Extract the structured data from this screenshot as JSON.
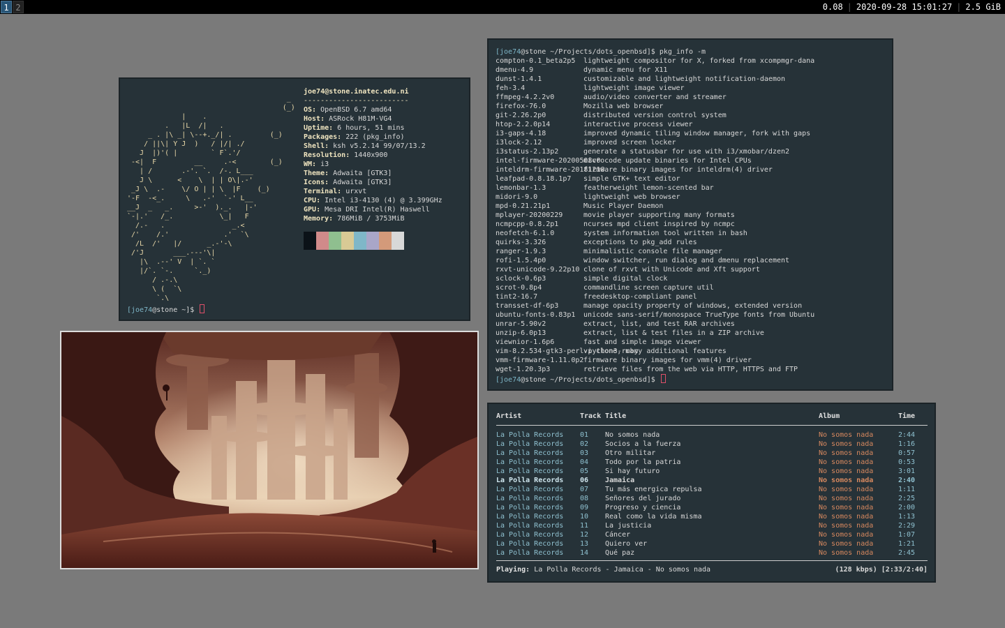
{
  "topbar": {
    "workspaces": [
      "1",
      "2"
    ],
    "load": "0.08",
    "datetime": "2020-09-28 15:01:27",
    "memory": "2.5 GiB"
  },
  "neofetch": {
    "title": "joe74@stone.inatec.edu.ni",
    "underline": "-------------------------",
    "info": [
      {
        "key": "OS",
        "value": "OpenBSD 6.7 amd64"
      },
      {
        "key": "Host",
        "value": "ASRock H81M-VG4"
      },
      {
        "key": "Uptime",
        "value": "6 hours, 51 mins"
      },
      {
        "key": "Packages",
        "value": "222 (pkg_info)"
      },
      {
        "key": "Shell",
        "value": "ksh v5.2.14 99/07/13.2"
      },
      {
        "key": "Resolution",
        "value": "1440x900"
      },
      {
        "key": "WM",
        "value": "i3"
      },
      {
        "key": "Theme",
        "value": "Adwaita [GTK3]"
      },
      {
        "key": "Icons",
        "value": "Adwaita [GTK3]"
      },
      {
        "key": "Terminal",
        "value": "urxvt"
      },
      {
        "key": "CPU",
        "value": "Intel i3-4130 (4) @ 3.399GHz"
      },
      {
        "key": "GPU",
        "value": "Mesa DRI Intel(R) Haswell"
      },
      {
        "key": "Memory",
        "value": "786MiB / 3753MiB"
      }
    ],
    "swatches": [
      "#0b1218",
      "#d08a8a",
      "#8fbf8f",
      "#d8ca95",
      "#7fb7c8",
      "#a9a6c8",
      "#d39a7a",
      "#d8d8d8"
    ],
    "prompt_user": "[joe74",
    "prompt_host": "@stone ~]$ "
  },
  "pkg": {
    "prompt_user": "[joe74",
    "prompt_rest": "@stone ~/Projects/dots_openbsd]$ ",
    "command": "pkg_info -m",
    "packages": [
      {
        "name": "compton-0.1_beta2p5",
        "desc": "lightweight compositor for X, forked from xcompmgr-dana"
      },
      {
        "name": "dmenu-4.9",
        "desc": "dynamic menu for X11"
      },
      {
        "name": "dunst-1.4.1",
        "desc": "customizable and lightweight notification-daemon"
      },
      {
        "name": "feh-3.4",
        "desc": "lightweight image viewer"
      },
      {
        "name": "ffmpeg-4.2.2v0",
        "desc": "audio/video converter and streamer"
      },
      {
        "name": "firefox-76.0",
        "desc": "Mozilla web browser"
      },
      {
        "name": "git-2.26.2p0",
        "desc": "distributed version control system"
      },
      {
        "name": "htop-2.2.0p14",
        "desc": "interactive process viewer"
      },
      {
        "name": "i3-gaps-4.18",
        "desc": "improved dynamic tiling window manager, fork with gaps"
      },
      {
        "name": "i3lock-2.12",
        "desc": "improved screen locker"
      },
      {
        "name": "i3status-2.13p2",
        "desc": "generate a statusbar for use with i3/xmobar/dzen2"
      },
      {
        "name": "intel-firmware-20200508v0",
        "desc": "microcode update binaries for Intel CPUs"
      },
      {
        "name": "inteldrm-firmware-20181218",
        "desc": "firmware binary images for inteldrm(4) driver"
      },
      {
        "name": "leafpad-0.8.18.1p7",
        "desc": "simple GTK+ text editor"
      },
      {
        "name": "lemonbar-1.3",
        "desc": "featherweight lemon-scented bar"
      },
      {
        "name": "midori-9.0",
        "desc": "lightweight web browser"
      },
      {
        "name": "mpd-0.21.21p1",
        "desc": "Music Player Daemon"
      },
      {
        "name": "mplayer-20200229",
        "desc": "movie player supporting many formats"
      },
      {
        "name": "ncmpcpp-0.8.2p1",
        "desc": "ncurses mpd client inspired by ncmpc"
      },
      {
        "name": "neofetch-6.1.0",
        "desc": "system information tool written in bash"
      },
      {
        "name": "quirks-3.326",
        "desc": "exceptions to pkg_add rules"
      },
      {
        "name": "ranger-1.9.3",
        "desc": "minimalistic console file manager"
      },
      {
        "name": "rofi-1.5.4p0",
        "desc": "window switcher, run dialog and dmenu replacement"
      },
      {
        "name": "rxvt-unicode-9.22p10",
        "desc": "clone of rxvt with Unicode and Xft support"
      },
      {
        "name": "sclock-0.6p3",
        "desc": "simple digital clock"
      },
      {
        "name": "scrot-0.8p4",
        "desc": "commandline screen capture util"
      },
      {
        "name": "tint2-16.7",
        "desc": "freedesktop-compliant panel"
      },
      {
        "name": "transset-df-6p3",
        "desc": "manage opacity property of windows, extended version"
      },
      {
        "name": "ubuntu-fonts-0.83p1",
        "desc": "unicode sans-serif/monospace TrueType fonts from Ubuntu"
      },
      {
        "name": "unrar-5.90v2",
        "desc": "extract, list, and test RAR archives"
      },
      {
        "name": "unzip-6.0p13",
        "desc": "extract, list & test files in a ZIP archive"
      },
      {
        "name": "viewnior-1.6p6",
        "desc": "fast and simple image viewer"
      },
      {
        "name": "vim-8.2.534-gtk3-perl-python3-ruby",
        "desc": "vi clone, many additional features"
      },
      {
        "name": "vmm-firmware-1.11.0p2",
        "desc": "firmware binary images for vmm(4) driver"
      },
      {
        "name": "wget-1.20.3p3",
        "desc": "retrieve files from the web via HTTP, HTTPS and FTP"
      }
    ]
  },
  "music": {
    "headers": {
      "artist": "Artist",
      "track": "Track",
      "title": "Title",
      "album": "Album",
      "time": "Time"
    },
    "tracks": [
      {
        "artist": "La Polla Records",
        "num": "01",
        "title": "No somos nada",
        "album": "No somos nada",
        "time": "2:44"
      },
      {
        "artist": "La Polla Records",
        "num": "02",
        "title": "Socios a la fuerza",
        "album": "No somos nada",
        "time": "1:16"
      },
      {
        "artist": "La Polla Records",
        "num": "03",
        "title": "Otro militar",
        "album": "No somos nada",
        "time": "0:57"
      },
      {
        "artist": "La Polla Records",
        "num": "04",
        "title": "Todo por la patria",
        "album": "No somos nada",
        "time": "0:53"
      },
      {
        "artist": "La Polla Records",
        "num": "05",
        "title": "Si hay futuro",
        "album": "No somos nada",
        "time": "3:01"
      },
      {
        "artist": "La Polla Records",
        "num": "06",
        "title": "Jamaica",
        "album": "No somos nada",
        "time": "2:40"
      },
      {
        "artist": "La Polla Records",
        "num": "07",
        "title": "Tu más energica repulsa",
        "album": "No somos nada",
        "time": "1:11"
      },
      {
        "artist": "La Polla Records",
        "num": "08",
        "title": "Señores del jurado",
        "album": "No somos nada",
        "time": "2:25"
      },
      {
        "artist": "La Polla Records",
        "num": "09",
        "title": "Progreso y ciencia",
        "album": "No somos nada",
        "time": "2:00"
      },
      {
        "artist": "La Polla Records",
        "num": "10",
        "title": "Real como la vida misma",
        "album": "No somos nada",
        "time": "1:13"
      },
      {
        "artist": "La Polla Records",
        "num": "11",
        "title": "La justicia",
        "album": "No somos nada",
        "time": "2:29"
      },
      {
        "artist": "La Polla Records",
        "num": "12",
        "title": "Cáncer",
        "album": "No somos nada",
        "time": "1:07"
      },
      {
        "artist": "La Polla Records",
        "num": "13",
        "title": "Quiero ver",
        "album": "No somos nada",
        "time": "1:21"
      },
      {
        "artist": "La Polla Records",
        "num": "14",
        "title": "Qué paz",
        "album": "No somos nada",
        "time": "2:45"
      }
    ],
    "playing_index": 5,
    "status_label": "Playing:",
    "status_text": "La Polla Records - Jamaica - No somos nada",
    "status_right": "(128 kbps) [2:33/2:40]"
  }
}
